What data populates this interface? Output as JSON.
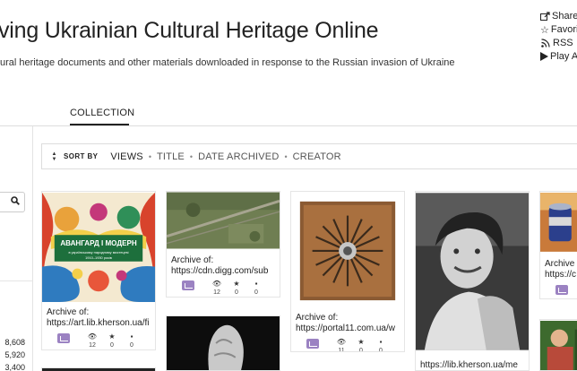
{
  "header": {
    "title": "ving Ukrainian Cultural Heritage Online",
    "subtitle": "ural heritage documents and other materials downloaded in response to the Russian invasion of Ukraine"
  },
  "actions": [
    {
      "label": "Share",
      "icon": "share-icon"
    },
    {
      "label": "Favorit",
      "icon": "star-outline-icon"
    },
    {
      "label": "RSS",
      "icon": "rss-icon"
    },
    {
      "label": "Play A",
      "icon": "play-icon"
    }
  ],
  "tabs": {
    "collection": "COLLECTION"
  },
  "left_counts": [
    "8,608",
    "5,920",
    "3,400"
  ],
  "sort": {
    "label": "SORT BY",
    "options": [
      "VIEWS",
      "TITLE",
      "DATE ARCHIVED",
      "CREATOR"
    ],
    "active": "VIEWS"
  },
  "cards": [
    {
      "caption1": "Archive of:",
      "caption2": "https://art.lib.kherson.ua/fi",
      "views": "12",
      "favs": "0",
      "comments": "0",
      "thumb_text1": "АВАНГАРД І МОДЕРН",
      "thumb_text2": "в українському народному мистецтві",
      "thumb_text3": "1910–1930 років"
    },
    {
      "caption1": "Archive of:",
      "caption2": "https://cdn.digg.com/sub",
      "views": "12",
      "favs": "0",
      "comments": "0"
    },
    {
      "caption1": "Archive of:",
      "caption2": "https://portal11.com.ua/w",
      "views": "11",
      "favs": "0",
      "comments": "0"
    },
    {
      "caption1": "",
      "caption2": "https://lib.kherson.ua/me"
    },
    {
      "caption1": "Archive o",
      "caption2": "https://c"
    }
  ],
  "colors": {
    "accent_purple": "#9b82c2",
    "border": "#dddddd"
  }
}
